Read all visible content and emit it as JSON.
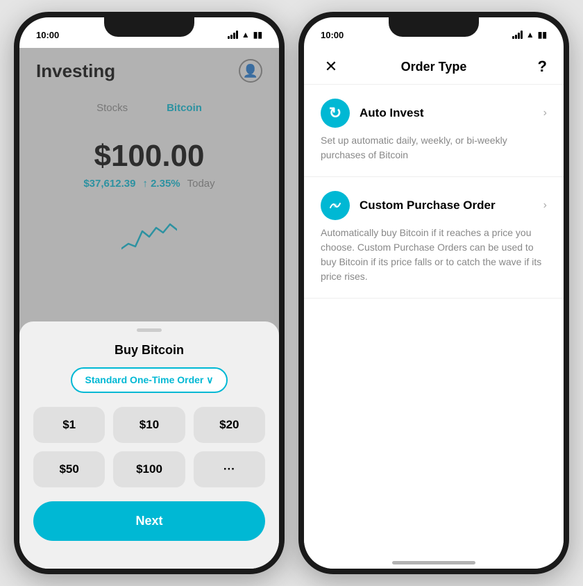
{
  "left": {
    "status_time": "10:00",
    "header": {
      "title": "Investing",
      "avatar_icon": "👤"
    },
    "tabs": [
      {
        "label": "Stocks",
        "active": false
      },
      {
        "label": "Bitcoin",
        "active": true
      }
    ],
    "price": {
      "main": "$100.00",
      "btc_price": "$37,612.39",
      "change": "↑ 2.35%",
      "period": "Today"
    },
    "sheet": {
      "title": "Buy Bitcoin",
      "order_type_label": "Standard One-Time Order ∨",
      "amounts": [
        "$1",
        "$10",
        "$20",
        "$50",
        "$100",
        "···"
      ],
      "next_label": "Next"
    }
  },
  "right": {
    "status_time": "10:00",
    "header": {
      "close_label": "✕",
      "title": "Order Type",
      "help_label": "?"
    },
    "order_types": [
      {
        "icon": "↻",
        "name": "Auto Invest",
        "description": "Set up automatic daily, weekly, or bi-weekly purchases of Bitcoin"
      },
      {
        "icon": "⟿",
        "name": "Custom Purchase Order",
        "description": "Automatically buy Bitcoin if it reaches a price you choose. Custom Purchase Orders can be used to buy Bitcoin if its price falls or to catch the wave if its price rises."
      }
    ]
  }
}
